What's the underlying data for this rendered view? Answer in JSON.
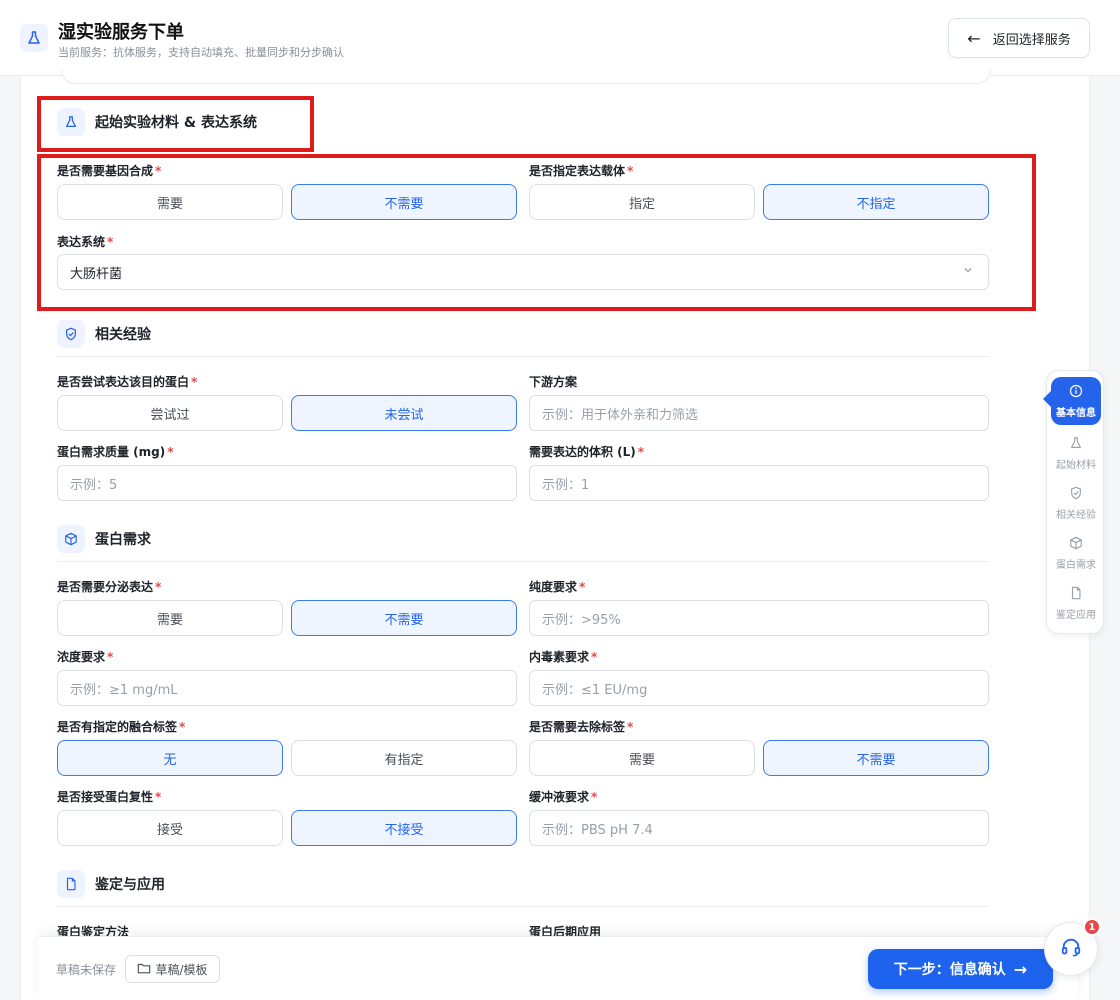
{
  "header": {
    "title": "湿实验服务下单",
    "subtitle": "当前服务：抗体服务，支持自动填充、批量同步和分步确认",
    "back_label": "返回选择服务"
  },
  "sections": {
    "materials": {
      "title": "起始实验材料 & 表达系统",
      "gene_synthesis": {
        "label": "是否需要基因合成",
        "options": [
          "需要",
          "不需要"
        ],
        "selected": "不需要"
      },
      "vector": {
        "label": "是否指定表达载体",
        "options": [
          "指定",
          "不指定"
        ],
        "selected": "不指定"
      },
      "expression_system": {
        "label": "表达系统",
        "value": "大肠杆菌"
      }
    },
    "experience": {
      "title": "相关经验",
      "tried": {
        "label": "是否尝试表达该目的蛋白",
        "options": [
          "尝试过",
          "未尝试"
        ],
        "selected": "未尝试"
      },
      "downstream": {
        "label": "下游方案",
        "placeholder": "示例：用于体外亲和力筛选"
      },
      "protein_mass": {
        "label": "蛋白需求质量 (mg)",
        "placeholder": "示例：5"
      },
      "volume": {
        "label": "需要表达的体积 (L)",
        "placeholder": "示例：1"
      }
    },
    "protein": {
      "title": "蛋白需求",
      "secretion": {
        "label": "是否需要分泌表达",
        "options": [
          "需要",
          "不需要"
        ],
        "selected": "不需要"
      },
      "purity": {
        "label": "纯度要求",
        "placeholder": "示例：>95%"
      },
      "concentration": {
        "label": "浓度要求",
        "placeholder": "示例：≥1 mg/mL"
      },
      "endotoxin": {
        "label": "内毒素要求",
        "placeholder": "示例：≤1 EU/mg"
      },
      "fusion_tag": {
        "label": "是否有指定的融合标签",
        "options": [
          "无",
          "有指定"
        ],
        "selected": "无"
      },
      "remove_tag": {
        "label": "是否需要去除标签",
        "options": [
          "需要",
          "不需要"
        ],
        "selected": "不需要"
      },
      "refolding": {
        "label": "是否接受蛋白复性",
        "options": [
          "接受",
          "不接受"
        ],
        "selected": "不接受"
      },
      "buffer": {
        "label": "缓冲液要求",
        "placeholder": "示例：PBS pH 7.4"
      }
    },
    "identification": {
      "title": "鉴定与应用",
      "method_label": "蛋白鉴定方法",
      "application_label": "蛋白后期应用"
    }
  },
  "sidenav": {
    "items": [
      {
        "label": "基本信息",
        "icon": "info-icon",
        "active": true
      },
      {
        "label": "起始材料",
        "icon": "flask-icon",
        "active": false
      },
      {
        "label": "相关经验",
        "icon": "shield-check-icon",
        "active": false
      },
      {
        "label": "蛋白需求",
        "icon": "cube-icon",
        "active": false
      },
      {
        "label": "鉴定应用",
        "icon": "file-icon",
        "active": false
      }
    ]
  },
  "footer": {
    "draft_status": "草稿未保存",
    "draft_button": "草稿/模板",
    "next_button": "下一步：信息确认"
  },
  "support": {
    "badge_count": "1"
  },
  "colors": {
    "primary": "#1d63ed",
    "selected_bg": "#eef5ff",
    "required": "#e5484d",
    "highlight_box": "#e01b1b"
  }
}
